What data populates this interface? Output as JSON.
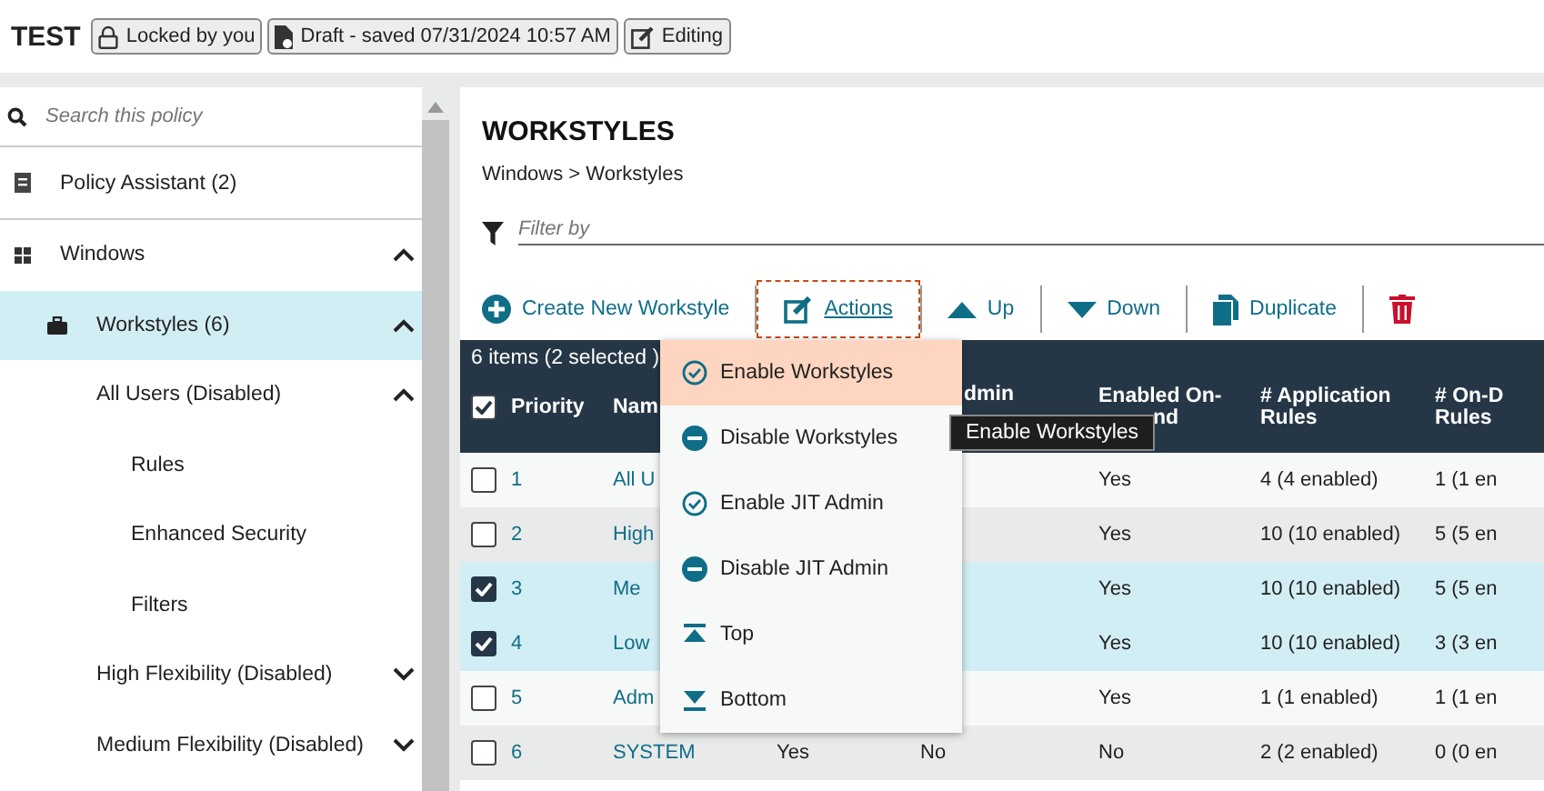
{
  "header": {
    "title": "TEST",
    "badges": [
      {
        "kind": "lock",
        "label": "Locked by you"
      },
      {
        "kind": "draft",
        "label": "Draft - saved 07/31/2024 10:57 AM"
      },
      {
        "kind": "edit",
        "label": "Editing"
      }
    ]
  },
  "sidebar": {
    "search": {
      "placeholder": "Search this policy"
    },
    "items": [
      {
        "label": "Policy Assistant (2)",
        "kind": "assistant",
        "selected": false
      },
      {
        "label": "Windows",
        "kind": "windows",
        "selected": false,
        "expanded": true,
        "children": [
          {
            "label": "Workstyles (6)",
            "kind": "briefcase",
            "selected": true,
            "expanded": true,
            "children": [
              {
                "label": "All Users (Disabled)",
                "selected": false,
                "expanded": true,
                "children": [
                  {
                    "label": "Rules",
                    "selected": false
                  },
                  {
                    "label": "Enhanced Security",
                    "selected": false
                  },
                  {
                    "label": "Filters",
                    "selected": false
                  }
                ]
              },
              {
                "label": "High Flexibility (Disabled)",
                "selected": false,
                "expanded": false
              },
              {
                "label": "Medium Flexibility (Disabled)",
                "selected": false,
                "expanded": false
              }
            ]
          }
        ]
      }
    ]
  },
  "main": {
    "title": "WORKSTYLES",
    "breadcrumb": "Windows > Workstyles",
    "filter": {
      "placeholder": "Filter by"
    },
    "toolbar": [
      {
        "kind": "create",
        "label": "Create New Workstyle"
      },
      {
        "kind": "actions",
        "label": "Actions"
      },
      {
        "kind": "up",
        "label": "Up"
      },
      {
        "kind": "down",
        "label": "Down"
      },
      {
        "kind": "duplicate",
        "label": "Duplicate"
      },
      {
        "kind": "delete"
      }
    ],
    "table": {
      "summary": "6 items (2 selected )",
      "all_checked": true,
      "columns": [
        {
          "label": "Priority"
        },
        {
          "label": "Nam"
        },
        {},
        {
          "label": "dmin"
        },
        {
          "label": "Enabled On-",
          "label_rest": "nd"
        },
        {
          "label": "# Application Rules"
        },
        {
          "label": "# On-D Rules"
        }
      ],
      "rows": [
        {
          "checked": false,
          "cells": [
            "1",
            "All U",
            null,
            null,
            "Yes",
            "4 (4 enabled)",
            "1 (1 en"
          ]
        },
        {
          "checked": false,
          "cells": [
            "2",
            "High",
            null,
            null,
            "Yes",
            "10 (10 enabled)",
            "5 (5 en"
          ]
        },
        {
          "checked": true,
          "cells": [
            "3",
            "Me",
            null,
            null,
            "Yes",
            "10 (10 enabled)",
            "5 (5 en"
          ]
        },
        {
          "checked": true,
          "cells": [
            "4",
            "Low",
            null,
            null,
            "Yes",
            "10 (10 enabled)",
            "3 (3 en"
          ]
        },
        {
          "checked": false,
          "cells": [
            "5",
            "Adm",
            null,
            null,
            "Yes",
            "1 (1 enabled)",
            "1 (1 en"
          ]
        },
        {
          "checked": false,
          "cells": [
            "6",
            "SYSTEM",
            "Yes",
            "No",
            "No",
            "2 (2 enabled)",
            "0 (0 en"
          ]
        }
      ]
    },
    "menu": {
      "items": [
        {
          "kind": "enable",
          "label": "Enable Workstyles",
          "selected": true
        },
        {
          "kind": "disable",
          "label": "Disable Workstyles",
          "selected": false
        },
        {
          "kind": "enable",
          "label": "Enable JIT Admin",
          "selected": false
        },
        {
          "kind": "disable",
          "label": "Disable JIT Admin",
          "selected": false
        },
        {
          "kind": "top",
          "label": "Top",
          "selected": false
        },
        {
          "kind": "bottom",
          "label": "Bottom",
          "selected": false
        }
      ]
    },
    "tooltip": "Enable Workstyles"
  }
}
